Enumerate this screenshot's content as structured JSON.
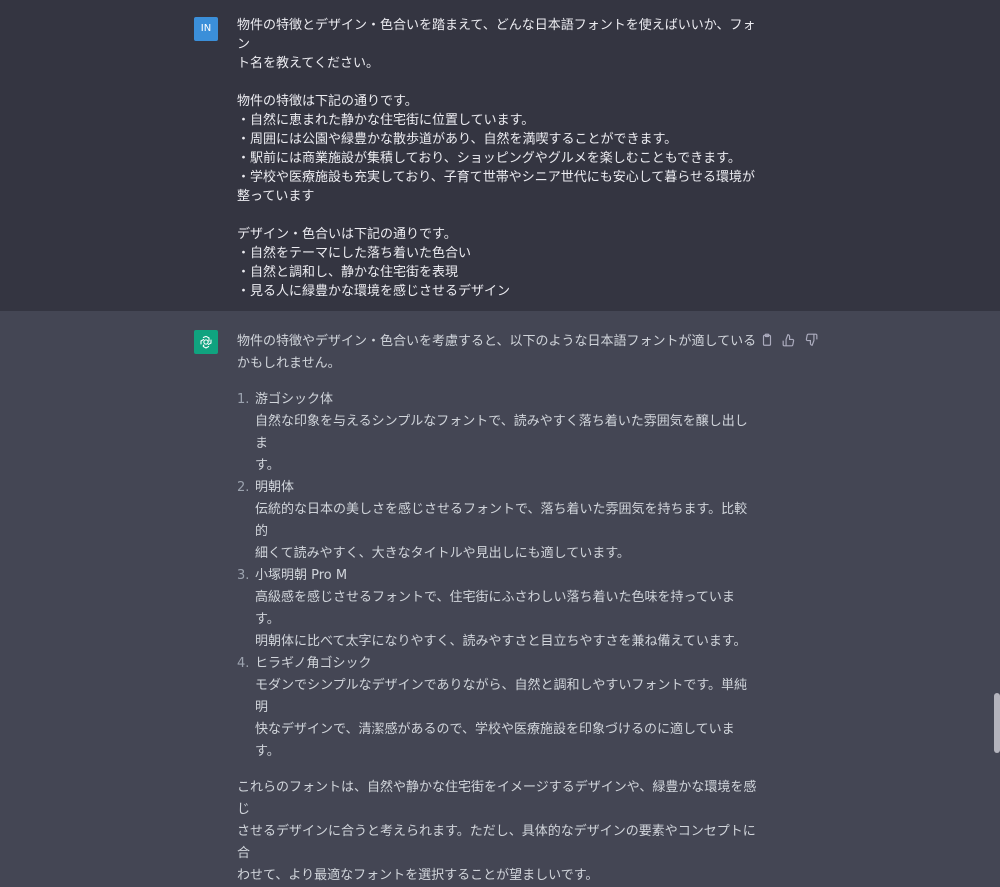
{
  "user_message": {
    "avatar_label": "IN",
    "lines": [
      "物件の特徴とデザイン・色合いを踏まえて、どんな日本語フォントを使えばいいか、フォン",
      "ト名を教えてください。",
      "",
      "物件の特徴は下記の通りです。",
      "・自然に恵まれた静かな住宅街に位置しています。",
      "・周囲には公園や緑豊かな散歩道があり、自然を満喫することができます。",
      "・駅前には商業施設が集積しており、ショッピングやグルメを楽しむこともできます。",
      "・学校や医療施設も充実しており、子育て世帯やシニア世代にも安心して暮らせる環境が",
      "整っています",
      "",
      "デザイン・色合いは下記の通りです。",
      "・自然をテーマにした落ち着いた色合い",
      "・自然と調和し、静かな住宅街を表現",
      "・見る人に緑豊かな環境を感じさせるデザイン"
    ]
  },
  "assistant_message": {
    "intro_line1": "物件の特徴やデザイン・色合いを考慮すると、以下のような日本語フォントが適している",
    "intro_line2": "かもしれません。",
    "fonts": [
      {
        "num": "1.",
        "name": "游ゴシック体",
        "desc1": "自然な印象を与えるシンプルなフォントで、読みやすく落ち着いた雰囲気を醸し出しま",
        "desc2": "す。"
      },
      {
        "num": "2.",
        "name": "明朝体",
        "desc1": "伝統的な日本の美しさを感じさせるフォントで、落ち着いた雰囲気を持ちます。比較的",
        "desc2": "細くて読みやすく、大きなタイトルや見出しにも適しています。"
      },
      {
        "num": "3.",
        "name": "小塚明朝 Pro M",
        "desc1": "高級感を感じさせるフォントで、住宅街にふさわしい落ち着いた色味を持っています。",
        "desc2": "明朝体に比べて太字になりやすく、読みやすさと目立ちやすさを兼ね備えています。"
      },
      {
        "num": "4.",
        "name": "ヒラギノ角ゴシック",
        "desc1": "モダンでシンプルなデザインでありながら、自然と調和しやすいフォントです。単純明",
        "desc2": "快なデザインで、清潔感があるので、学校や医療施設を印象づけるのに適しています。"
      }
    ],
    "outro_line1": "これらのフォントは、自然や静かな住宅街をイメージするデザインや、緑豊かな環境を感じ",
    "outro_line2": "させるデザインに合うと考えられます。ただし、具体的なデザインの要素やコンセプトに合",
    "outro_line3": "わせて、より最適なフォントを選択することが望ましいです。"
  },
  "icons": {
    "copy": "clipboard-icon",
    "like": "thumbs-up-icon",
    "dislike": "thumbs-down-icon",
    "assistant_avatar": "openai-logo-icon"
  },
  "colors": {
    "user_bg": "#343541",
    "assistant_bg": "#444654",
    "user_avatar": "#3b8fd9",
    "assistant_avatar": "#10a37f"
  }
}
